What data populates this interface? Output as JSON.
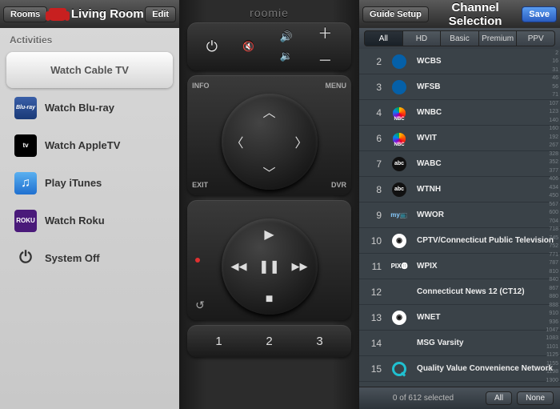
{
  "left": {
    "rooms_btn": "Rooms",
    "title": "Living Room",
    "edit_btn": "Edit",
    "section": "Activities",
    "activities": [
      {
        "label": "Watch Cable TV",
        "icon": "",
        "selected": true
      },
      {
        "label": "Watch Blu-ray",
        "icon": "bluray"
      },
      {
        "label": "Watch AppleTV",
        "icon": "appletv"
      },
      {
        "label": "Play iTunes",
        "icon": "itunes"
      },
      {
        "label": "Watch Roku",
        "icon": "roku"
      },
      {
        "label": "System Off",
        "icon": "power"
      }
    ]
  },
  "remote": {
    "logo": "roomie",
    "nav": {
      "tl": "INFO",
      "tr": "MENU",
      "bl": "EXIT",
      "br": "DVR"
    },
    "numbers": [
      "1",
      "2",
      "3"
    ]
  },
  "right": {
    "guide_btn": "Guide Setup",
    "title": "Channel Selection",
    "save_btn": "Save",
    "filters": [
      "All",
      "HD",
      "Basic",
      "Premium",
      "PPV"
    ],
    "filter_selected": 0,
    "channels": [
      {
        "num": "2",
        "name": "WCBS",
        "logo": "cbs"
      },
      {
        "num": "3",
        "name": "WFSB",
        "logo": "cbs"
      },
      {
        "num": "4",
        "name": "WNBC",
        "logo": "nbc"
      },
      {
        "num": "6",
        "name": "WVIT",
        "logo": "nbc"
      },
      {
        "num": "7",
        "name": "WABC",
        "logo": "abc"
      },
      {
        "num": "8",
        "name": "WTNH",
        "logo": "abc"
      },
      {
        "num": "9",
        "name": "WWOR",
        "logo": "my"
      },
      {
        "num": "10",
        "name": "CPTV/Connecticut Public Television",
        "logo": "pbs"
      },
      {
        "num": "11",
        "name": "WPIX",
        "logo": "pix"
      },
      {
        "num": "12",
        "name": "Connecticut News 12 (CT12)",
        "logo": ""
      },
      {
        "num": "13",
        "name": "WNET",
        "logo": "pbs"
      },
      {
        "num": "14",
        "name": "MSG Varsity",
        "logo": ""
      },
      {
        "num": "15",
        "name": "Quality Value Convenience Network",
        "logo": "qvc"
      }
    ],
    "index": [
      "2",
      "16",
      "31",
      "46",
      "56",
      "71",
      "107",
      "123",
      "140",
      "160",
      "192",
      "267",
      "328",
      "352",
      "377",
      "406",
      "434",
      "450",
      "567",
      "600",
      "704",
      "718",
      "745",
      "752",
      "771",
      "787",
      "810",
      "840",
      "867",
      "880",
      "888",
      "910",
      "936",
      "1047",
      "1083",
      "1101",
      "1125",
      "1155",
      "1198",
      "1300"
    ],
    "status": "0 of 612 selected",
    "all_btn": "All",
    "none_btn": "None"
  }
}
